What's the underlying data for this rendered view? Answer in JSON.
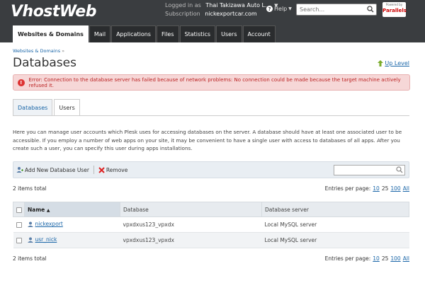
{
  "header": {
    "logo": "VhostWeb",
    "logged_in_label": "Logged in as",
    "logged_in_value": "Thai Takizawa Auto L...",
    "subscription_label": "Subscription",
    "subscription_value": "nickexportcar.com",
    "help_label": "Help",
    "search_placeholder": "Search...",
    "brand_powered": "Powered by",
    "brand_name": "Parallels"
  },
  "nav": {
    "tabs": [
      {
        "label": "Websites & Domains",
        "active": true
      },
      {
        "label": "Mail"
      },
      {
        "label": "Applications"
      },
      {
        "label": "Files"
      },
      {
        "label": "Statistics"
      },
      {
        "label": "Users"
      },
      {
        "label": "Account"
      }
    ]
  },
  "page": {
    "breadcrumb": "Websites & Domains",
    "breadcrumb_sep": "»",
    "title": "Databases",
    "up_level": "Up Level",
    "error": "Error: Connection to the database server has failed because of network problems: No connection could be made because the target machine actively refused it.",
    "subtabs": [
      {
        "label": "Databases"
      },
      {
        "label": "Users",
        "active": true
      }
    ],
    "description": "Here you can manage user accounts which Plesk uses for accessing databases on the server. A database should have at least one associated user to be accessible. If you employ a number of web apps on your site, it may be convenient to have a single user with access to databases of all apps. After you create such a user, you can specify this user during apps installations."
  },
  "toolbar": {
    "add_label": "Add New Database User",
    "remove_label": "Remove"
  },
  "list": {
    "total": "2 items total",
    "entries_label": "Entries per page:",
    "per_page": [
      "10",
      "25",
      "100",
      "All"
    ],
    "columns": [
      "Name",
      "Database",
      "Database server"
    ],
    "rows": [
      {
        "name": "nickexport",
        "database": "vpxdxus123_vpxdx",
        "server": "Local MySQL server"
      },
      {
        "name": "usr_nick",
        "database": "vpxdxus123_vpxdx",
        "server": "Local MySQL server"
      }
    ]
  },
  "colors": {
    "header_bg": "#3a3d40",
    "link": "#1a66a8",
    "error_bg": "#f6d7d7",
    "error_text": "#bb2222"
  }
}
